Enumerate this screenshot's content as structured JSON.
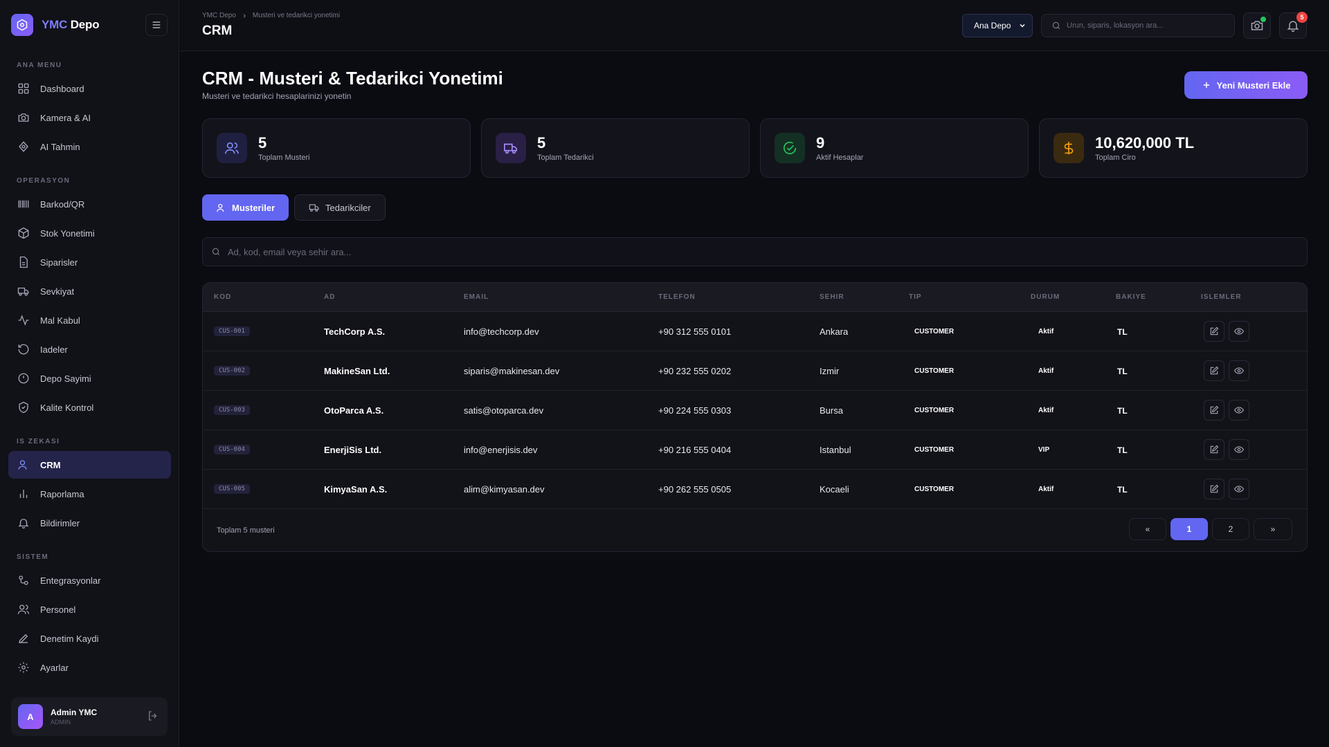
{
  "brand": {
    "name_a": "YMC",
    "name_b": "Depo"
  },
  "sidebar": {
    "sections": [
      {
        "title": "ANA MENU",
        "items": [
          {
            "label": "Dashboard",
            "icon": "grid-icon"
          },
          {
            "label": "Kamera & AI",
            "icon": "camera-icon"
          },
          {
            "label": "AI Tahmin",
            "icon": "ai-icon"
          }
        ]
      },
      {
        "title": "OPERASYON",
        "items": [
          {
            "label": "Barkod/QR",
            "icon": "barcode-icon"
          },
          {
            "label": "Stok Yonetimi",
            "icon": "box-icon"
          },
          {
            "label": "Siparisler",
            "icon": "document-icon"
          },
          {
            "label": "Sevkiyat",
            "icon": "truck-icon"
          },
          {
            "label": "Mal Kabul",
            "icon": "activity-icon"
          },
          {
            "label": "Iadeler",
            "icon": "return-icon"
          },
          {
            "label": "Depo Sayimi",
            "icon": "clock-icon"
          },
          {
            "label": "Kalite Kontrol",
            "icon": "shield-icon"
          }
        ]
      },
      {
        "title": "IS ZEKASI",
        "items": [
          {
            "label": "CRM",
            "icon": "users-icon",
            "active": true
          },
          {
            "label": "Raporlama",
            "icon": "bar-chart-icon"
          },
          {
            "label": "Bildirimler",
            "icon": "bell-icon"
          }
        ]
      },
      {
        "title": "SISTEM",
        "items": [
          {
            "label": "Entegrasyonlar",
            "icon": "integration-icon"
          },
          {
            "label": "Personel",
            "icon": "people-icon"
          },
          {
            "label": "Denetim Kaydi",
            "icon": "pen-icon"
          },
          {
            "label": "Ayarlar",
            "icon": "gear-icon"
          }
        ]
      }
    ],
    "user": {
      "initial": "A",
      "name": "Admin YMC",
      "role": "ADMIN"
    }
  },
  "topbar": {
    "breadcrumb": [
      "YMC Depo",
      "Musteri ve tedarikci yonetimi"
    ],
    "title": "CRM",
    "warehouse_selected": "Ana Depo",
    "search_placeholder": "Urun, siparis, lokasyon ara...",
    "notification_count": "5"
  },
  "page": {
    "title": "CRM - Musteri & Tedarikci Yonetimi",
    "subtitle": "Musteri ve tedarikci hesaplarinizi yonetin",
    "add_button": "Yeni Musteri Ekle"
  },
  "stats": [
    {
      "value": "5",
      "label": "Toplam Musteri",
      "icon": "users-icon",
      "color": "#818cf8"
    },
    {
      "value": "5",
      "label": "Toplam Tedarikci",
      "icon": "truck-icon",
      "color": "#a78bfa"
    },
    {
      "value": "9",
      "label": "Aktif Hesaplar",
      "icon": "check-circle-icon",
      "color": "#22c55e"
    },
    {
      "value": "10,620,000 TL",
      "label": "Toplam Ciro",
      "icon": "dollar-icon",
      "color": "#f59e0b"
    }
  ],
  "tabs": [
    {
      "label": "Musteriler"
    },
    {
      "label": "Tedarikciler"
    }
  ],
  "filter_placeholder": "Ad, kod, email veya sehir ara...",
  "table": {
    "columns": [
      "KOD",
      "AD",
      "EMAIL",
      "TELEFON",
      "SEHIR",
      "TIP",
      "DURUM",
      "BAKIYE",
      "ISLEMLER"
    ],
    "rows": [
      {
        "code": "CUS-001",
        "name": "TechCorp A.S.",
        "email": "info@techcorp.dev",
        "phone": "+90 312 555 0101",
        "city": "Ankara",
        "type": "CUSTOMER",
        "status": "Aktif",
        "balance": "TL"
      },
      {
        "code": "CUS-002",
        "name": "MakineSan Ltd.",
        "email": "siparis@makinesan.dev",
        "phone": "+90 232 555 0202",
        "city": "Izmir",
        "type": "CUSTOMER",
        "status": "Aktif",
        "balance": "TL"
      },
      {
        "code": "CUS-003",
        "name": "OtoParca A.S.",
        "email": "satis@otoparca.dev",
        "phone": "+90 224 555 0303",
        "city": "Bursa",
        "type": "CUSTOMER",
        "status": "Aktif",
        "balance": "TL"
      },
      {
        "code": "CUS-004",
        "name": "EnerjiSis Ltd.",
        "email": "info@enerjisis.dev",
        "phone": "+90 216 555 0404",
        "city": "Istanbul",
        "type": "CUSTOMER",
        "status": "VIP",
        "balance": "TL"
      },
      {
        "code": "CUS-005",
        "name": "KimyaSan A.S.",
        "email": "alim@kimyasan.dev",
        "phone": "+90 262 555 0505",
        "city": "Kocaeli",
        "type": "CUSTOMER",
        "status": "Aktif",
        "balance": "TL"
      }
    ],
    "total_text": "Toplam 5 musteri",
    "pagination": {
      "prev": "«",
      "pages": [
        "1",
        "2"
      ],
      "next": "»",
      "current": "1"
    }
  },
  "colors": {
    "accent": "#6366f1",
    "accent2": "#8b5cf6",
    "background": "#0b0b12",
    "danger": "#ef4444",
    "success": "#22c55e"
  }
}
